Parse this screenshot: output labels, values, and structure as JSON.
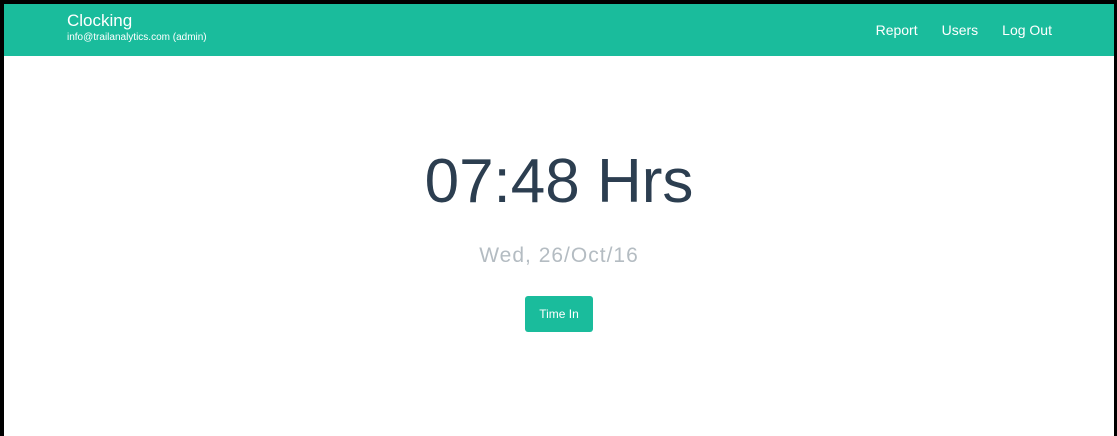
{
  "colors": {
    "accent": "#1abc9c",
    "primary_text": "#2c3e50",
    "muted_text": "#b4bcc2"
  },
  "navbar": {
    "title": "Clocking",
    "user": "info@trailanalytics.com (admin)",
    "links": [
      {
        "label": "Report"
      },
      {
        "label": "Users"
      },
      {
        "label": "Log Out"
      }
    ]
  },
  "main": {
    "hours": "07:48 Hrs",
    "date": "Wed, 26/Oct/16",
    "time_in_button": "Time In"
  }
}
